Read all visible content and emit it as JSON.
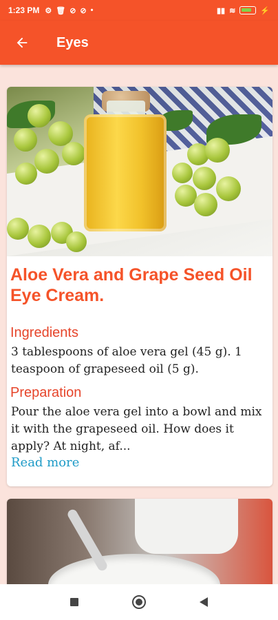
{
  "status": {
    "time": "1:23 PM",
    "battery_level": 0.6
  },
  "app_bar": {
    "title": "Eyes"
  },
  "recipes": [
    {
      "title": "Aloe Vera and Grape Seed Oil Eye Cream.",
      "ingredients_label": "Ingredients",
      "ingredients_text": "3 tablespoons of aloe vera gel (45 g). 1 teaspoon of grapeseed oil (5 g).",
      "preparation_label": "Preparation",
      "preparation_text": "Pour the aloe vera gel into a bowl and mix it with the grapeseed oil. How does it apply? At night, af...",
      "read_more_label": "Read more"
    }
  ],
  "colors": {
    "accent": "#f55329",
    "section_label": "#e6452b",
    "link": "#1f9bc7",
    "background": "#fbe3dc"
  }
}
